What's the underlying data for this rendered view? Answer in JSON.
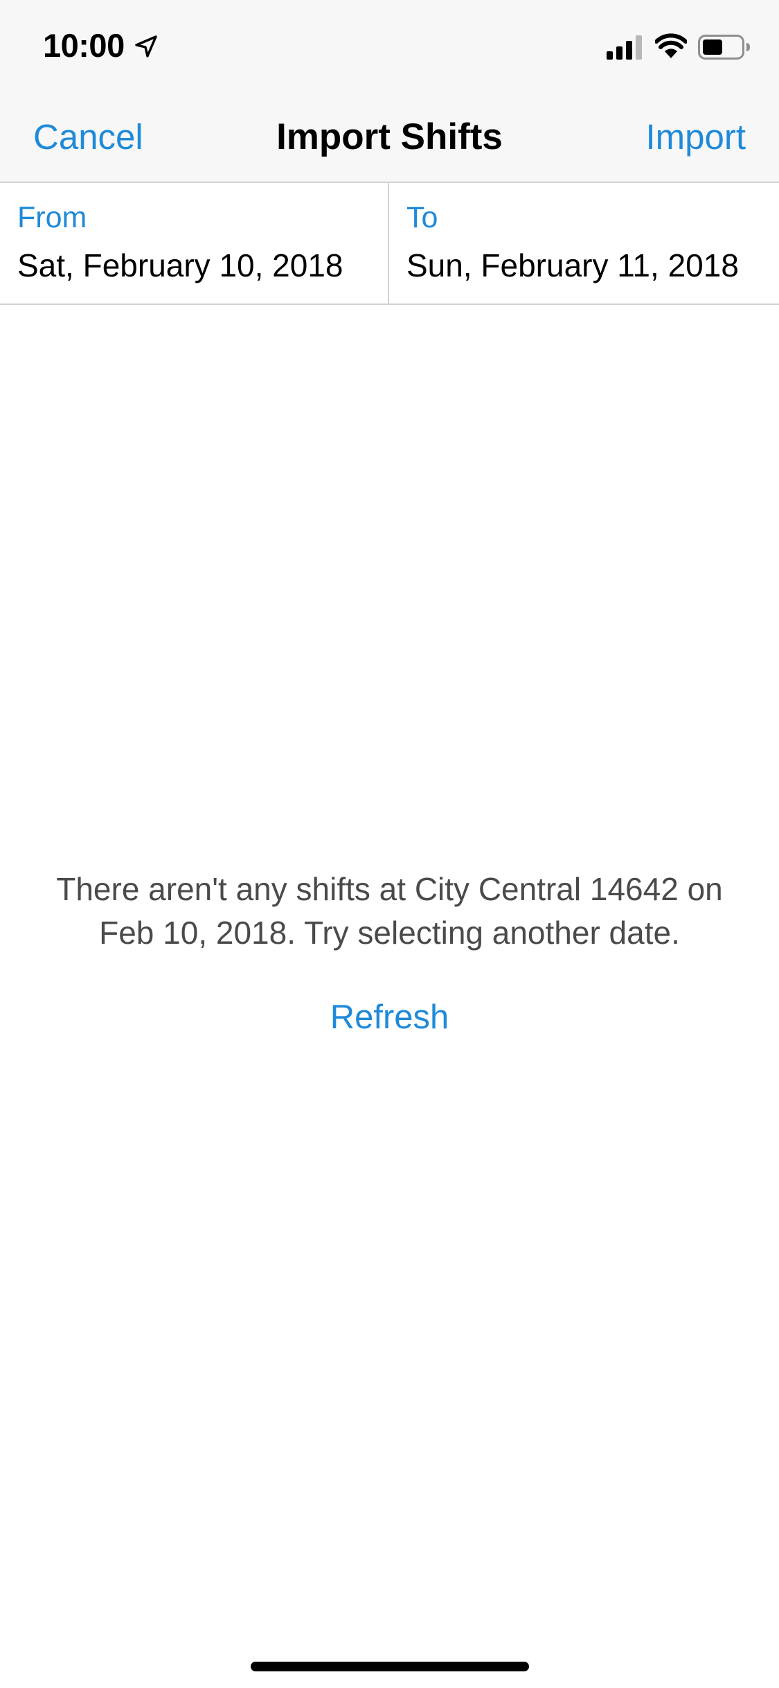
{
  "status_bar": {
    "time": "10:00",
    "icons": [
      "location-arrow-icon",
      "cellular-signal-icon",
      "wifi-icon",
      "battery-icon"
    ]
  },
  "nav": {
    "cancel_label": "Cancel",
    "title": "Import Shifts",
    "import_label": "Import"
  },
  "dates": {
    "from_label": "From",
    "from_value": "Sat, February 10, 2018",
    "to_label": "To",
    "to_value": "Sun, February 11, 2018"
  },
  "empty_state": {
    "message": "There aren't any shifts at City Central 14642 on Feb 10, 2018. Try selecting another date.",
    "refresh_label": "Refresh"
  },
  "colors": {
    "accent": "#1f8ad9",
    "nav_background": "#f7f7f7",
    "separator": "#d2d2d2",
    "message_text": "#4a4a4a"
  }
}
